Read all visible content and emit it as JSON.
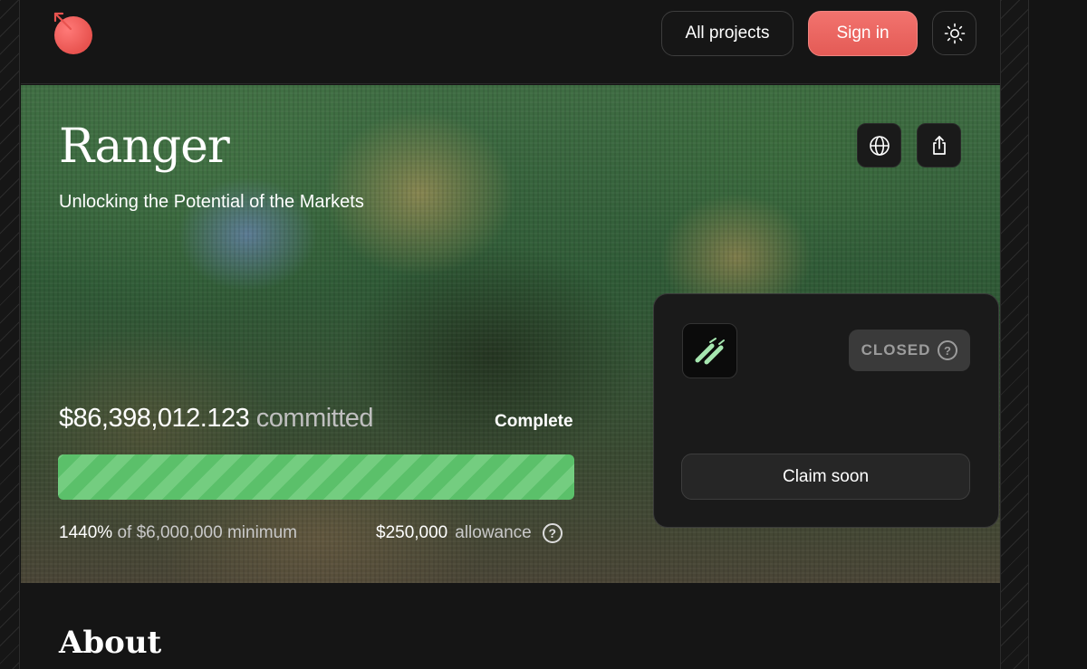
{
  "header": {
    "all_projects_label": "All projects",
    "sign_in_label": "Sign in",
    "theme_icon": "sun-icon",
    "logo_icon": "logo-icon"
  },
  "hero": {
    "title": "Ranger",
    "subtitle": "Unlocking the Potential of the Markets",
    "globe_icon": "globe-icon",
    "share_icon": "share-icon"
  },
  "funding": {
    "committed_amount": "$86,398,012.123",
    "committed_word": "committed",
    "status": "Complete",
    "progress_fraction": 1.0,
    "percent": "1440%",
    "minimum_text": "of $6,000,000 minimum",
    "allowance_amount": "$250,000",
    "allowance_word": "allowance",
    "help_glyph": "?"
  },
  "card": {
    "badge_label": "CLOSED",
    "badge_help": "?",
    "claim_label": "Claim soon",
    "logo_icon": "ranger-logo-icon"
  },
  "about": {
    "heading": "About"
  },
  "colors": {
    "accent": "#e8534f",
    "progress": "#5bc06a",
    "background": "#151515"
  }
}
